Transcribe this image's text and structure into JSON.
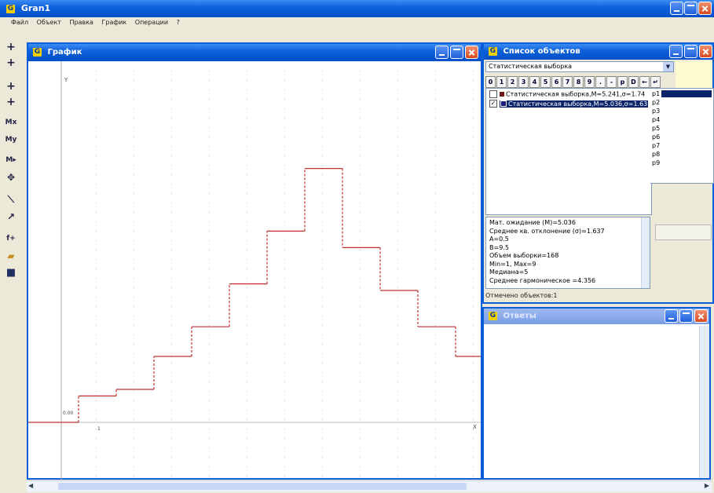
{
  "app": {
    "title": "Gran1",
    "icon_letter": "G"
  },
  "menu": [
    "Файл",
    "Объект",
    "Правка",
    "График",
    "Операции",
    "?"
  ],
  "left_toolbar": {
    "tools": [
      {
        "name": "cross-tool-icon",
        "glyph": "+"
      },
      {
        "name": "cross-tool-2-icon",
        "glyph": "+"
      },
      {
        "name": "add-point-icon",
        "glyph": "+"
      },
      {
        "name": "add-point-2-icon",
        "glyph": "+"
      },
      {
        "name": "mx-tool-icon",
        "glyph": "Mx"
      },
      {
        "name": "my-tool-icon",
        "glyph": "My"
      },
      {
        "name": "m-move-tool-icon",
        "glyph": "M▸"
      },
      {
        "name": "move-tool-icon",
        "glyph": "✥"
      },
      {
        "name": "segment-tool-icon",
        "glyph": "⟍"
      },
      {
        "name": "pointer-tool-icon",
        "glyph": "↗"
      },
      {
        "name": "function-tool-icon",
        "glyph": "f+"
      },
      {
        "name": "open-folder-icon",
        "glyph": "▰"
      },
      {
        "name": "save-disk-icon",
        "glyph": "■"
      }
    ]
  },
  "graph_window": {
    "title": "График",
    "y_axis_label": "Y",
    "x_axis_label": "X",
    "origin_y_label": "0.00",
    "x_tick_label": "1",
    "chart_data": {
      "type": "line",
      "x": [
        1,
        2,
        3,
        4,
        5,
        6,
        7,
        8,
        9,
        10,
        11
      ],
      "y": [
        0.08,
        0.1,
        0.2,
        0.29,
        0.42,
        0.58,
        0.77,
        0.53,
        0.4,
        0.29,
        0.2,
        0.11,
        0.0
      ],
      "note_steps": "staircase cumulative sample polygon",
      "ylim": [
        0,
        1
      ]
    }
  },
  "objects_window": {
    "title": "Список объектов",
    "dropdown_value": "Статистическая выборка",
    "key_buttons": [
      "0",
      "1",
      "2",
      "3",
      "4",
      "5",
      "6",
      "7",
      "8",
      "9",
      ".",
      "-",
      "p",
      "D",
      "←",
      "↵"
    ],
    "items": [
      {
        "label": "Статистическая выборка,M=5.241,σ=1.74",
        "checked": false,
        "color": "#6a1818",
        "selected": false
      },
      {
        "label": "Статистическая выборка,M=5.036,σ=1.63",
        "checked": true,
        "color": "#1a1a80",
        "selected": true
      }
    ],
    "params": [
      "p1",
      "p2",
      "p3",
      "p4",
      "p5",
      "p6",
      "p7",
      "p8",
      "p9"
    ],
    "info_lines": [
      "Мат. ожидание (M)=5.036",
      "Среднее кв. отклонение (σ)=1.637",
      "A=0.5",
      "B=9.5",
      "Объем выборки=168",
      "Min=1, Max=9",
      "Медиана=5",
      "Среднее гармоническое =4.356"
    ],
    "status": "Отмечено объектов:1"
  },
  "answers_window": {
    "title": "Ответы"
  },
  "colors": {
    "title_blue": "#0a5fd8",
    "graph_line": "#c03030",
    "grid_dot": "#bbbbbb"
  }
}
